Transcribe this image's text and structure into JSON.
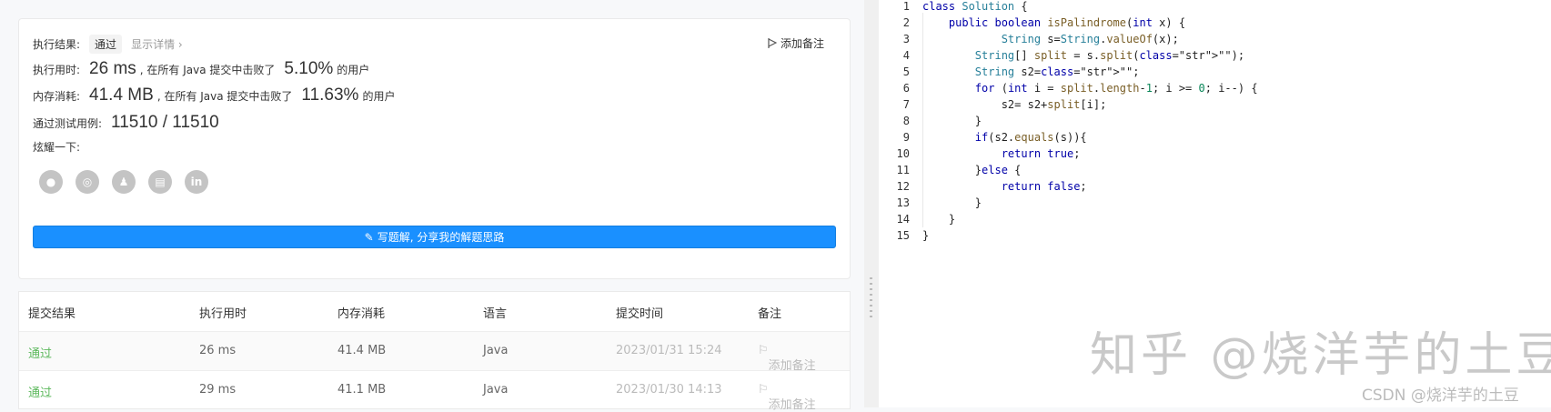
{
  "result_card": {
    "result_label": "执行结果:",
    "result_value": "通过",
    "show_details": "显示详情 ›",
    "add_note": "添加备注",
    "runtime_label": "执行用时:",
    "runtime_value": "26 ms",
    "runtime_mid": ", 在所有 Java 提交中击败了",
    "runtime_pct": "5.10%",
    "runtime_suffix": "的用户",
    "memory_label": "内存消耗:",
    "memory_value": "41.4 MB",
    "memory_mid": ", 在所有 Java 提交中击败了",
    "memory_pct": "11.63%",
    "memory_suffix": "的用户",
    "tests_label": "通过测试用例:",
    "tests_value": "11510 / 11510",
    "share_label": "炫耀一下:",
    "share_icons": [
      "wechat-icon",
      "weibo-icon",
      "qq-icon",
      "douban-icon",
      "linkedin-icon"
    ],
    "write_solution": "写题解, 分享我的解题思路"
  },
  "submissions": {
    "headers": [
      "提交结果",
      "执行用时",
      "内存消耗",
      "语言",
      "提交时间",
      "备注"
    ],
    "rows": [
      {
        "status": "通过",
        "time": "26 ms",
        "memory": "41.4 MB",
        "lang": "Java",
        "date": "2023/01/31 15:24",
        "note": "添加备注"
      },
      {
        "status": "通过",
        "time": "29 ms",
        "memory": "41.1 MB",
        "lang": "Java",
        "date": "2023/01/30 14:13",
        "note": "添加备注"
      }
    ]
  },
  "code": {
    "line_numbers": [
      "1",
      "2",
      "3",
      "4",
      "5",
      "6",
      "7",
      "8",
      "9",
      "10",
      "11",
      "12",
      "13",
      "14",
      "15"
    ],
    "lines": [
      "class Solution {",
      "    public boolean isPalindrome(int x) {",
      "            String s=String.valueOf(x);",
      "        String[] split = s.split(\"\");",
      "        String s2=\"\";",
      "        for (int i = split.length-1; i >= 0; i--) {",
      "            s2= s2+split[i];",
      "        }",
      "        if(s2.equals(s)){",
      "            return true;",
      "        }else {",
      "            return false;",
      "        }",
      "    }",
      "}"
    ]
  },
  "watermark": "知乎 @烧洋芋的土豆",
  "csdn_mark": "CSDN @烧洋芋的土豆",
  "colors": {
    "accent": "#1a90ff",
    "pass": "#5cb85c"
  }
}
